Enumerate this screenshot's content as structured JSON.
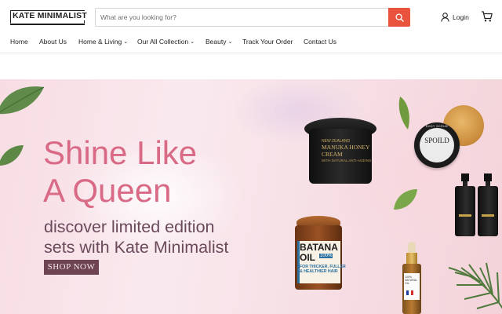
{
  "brand": {
    "logo_text": "KATE MINIMALIST"
  },
  "search": {
    "placeholder": "What are you looking for?"
  },
  "account": {
    "login_label": "Login"
  },
  "nav": {
    "items": [
      {
        "label": "Home"
      },
      {
        "label": "About Us"
      },
      {
        "label": "Home & Living",
        "caret": "⌄"
      },
      {
        "label": "Our All Collection",
        "caret": "⌄"
      },
      {
        "label": "Beauty",
        "caret": "⌄"
      },
      {
        "label": "Track Your Order"
      },
      {
        "label": "Contact Us"
      }
    ]
  },
  "hero": {
    "headline_line1": "Shine Like",
    "headline_line2": "A Queen",
    "subline_line1": "discover limited edition",
    "subline_line2": "sets with Kate Minimalist",
    "cta_label": "SHOP NOW"
  },
  "products": {
    "manuka": {
      "top": "NEW ZEALAND",
      "name_line1": "MANUKA HONEY",
      "name_line2": "CREAM",
      "sub": "WITH NATURAL ANTI-AGEING"
    },
    "spoild": {
      "name": "SPOILD",
      "ring": "BODY SCRUB"
    },
    "batana": {
      "line1": "BATANA",
      "line2": "OIL",
      "badge": "100%",
      "tag_line1": "FOR THICKER, FULLER",
      "tag_line2": "& HEALTHIER HAIR"
    },
    "dropper": {
      "label": "100% NATURAL OIL"
    }
  },
  "colors": {
    "accent": "#e9533d",
    "headline": "#d96a86",
    "subline": "#6b4a5b",
    "cta_bg": "#6e4452"
  },
  "icons": {
    "search": "search-icon",
    "user": "user-icon",
    "cart": "cart-icon"
  }
}
